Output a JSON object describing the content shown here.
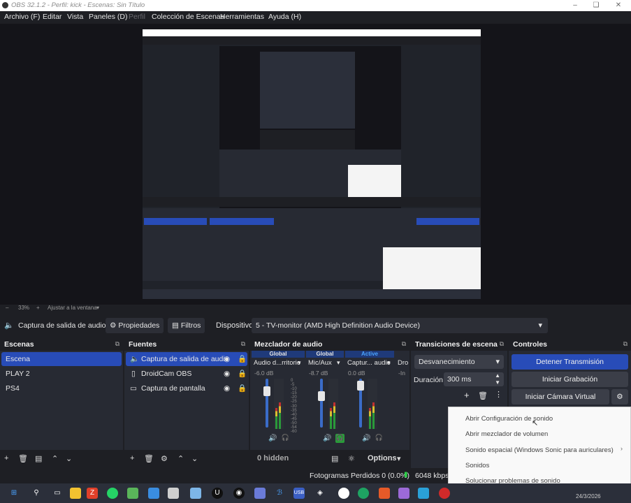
{
  "window": {
    "title": "OBS 32.1.2 - Perfil: kick - Escenas: Sin Título"
  },
  "menu": [
    "Archivo (F)",
    "Editar",
    "Vista",
    "Paneles (D)",
    "Perfil",
    "Colección de Escenas",
    "Herramientas",
    "Ayuda (H)"
  ],
  "status_mini": {
    "zoom": "33%",
    "fit": "Ajustar a la ventana"
  },
  "toolbar": {
    "source": "Captura de salida de audio",
    "properties": "Propiedades",
    "filters": "Filtros",
    "device_label": "Dispositivo",
    "device_value": "5 - TV-monitor (AMD High Definition Audio Device)"
  },
  "scenes": {
    "title": "Escenas",
    "items": [
      "Escena",
      "PLAY 2",
      "PS4"
    ]
  },
  "sources": {
    "title": "Fuentes",
    "items": [
      "Captura de salida de audio",
      "DroidCam OBS",
      "Captura de pantalla"
    ]
  },
  "mixer": {
    "title": "Mezclador de audio",
    "channels": [
      {
        "tag": "Global",
        "name": "Audio d...rritorio",
        "db": "-6.0 dB"
      },
      {
        "tag": "Global",
        "name": "Mic/Aux",
        "db": "-8.7 dB"
      },
      {
        "tag": "Active",
        "name": "Captur... audio",
        "db": "0.0 dB"
      },
      {
        "tag": "",
        "name": "Dro",
        "db": "-In"
      }
    ],
    "scale": [
      "0",
      "-5",
      "-10",
      "-15",
      "-20",
      "-25",
      "-30",
      "-35",
      "-40",
      "-45",
      "-50",
      "-54",
      "-60"
    ],
    "hidden": "0 hidden",
    "options": "Options"
  },
  "transitions": {
    "title": "Transiciones de escena",
    "type": "Desvanecimiento",
    "duration_label": "Duración",
    "duration_value": "300 ms"
  },
  "controls": {
    "title": "Controles",
    "stop_stream": "Detener Transmisión",
    "start_recording": "Iniciar Grabación",
    "virtual_cam": "Iniciar Cámara Virtual"
  },
  "context_menu": [
    "Abrir Configuración de sonido",
    "Abrir mezclador de volumen",
    "Sonido espacial (Windows Sonic para auriculares)",
    "Sonidos",
    "Solucionar problemas de sonido"
  ],
  "status": {
    "dropped": "Fotogramas Perdidos 0 (0.0%)",
    "bitrate": "6048 kbps"
  },
  "clock": {
    "date": "24/3/2026"
  },
  "colors": {
    "accent": "#284cb8",
    "bg": "#1e1f24",
    "dock": "#272a33"
  }
}
